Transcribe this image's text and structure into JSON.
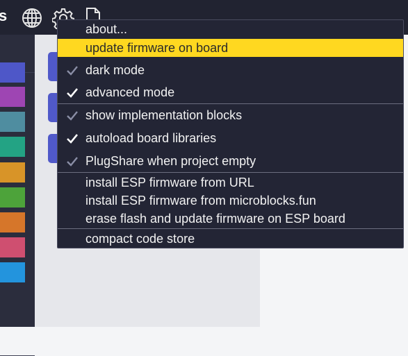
{
  "topbar": {
    "title_fragment": "s",
    "icons": [
      "globe-icon",
      "gear-icon",
      "file-icon"
    ]
  },
  "palette": {
    "category_colors": [
      "#4e57c8",
      "#9e45b3",
      "#4f8da0",
      "#23a384",
      "#d89428",
      "#4da33a",
      "#d6762a",
      "#cf4f70",
      "#2394dd"
    ]
  },
  "menu": {
    "items": [
      {
        "label": "about...",
        "check": "none",
        "highlight": false
      },
      {
        "label": "update firmware on board",
        "check": "none",
        "highlight": true
      },
      {
        "label": "dark mode",
        "check": "dim",
        "highlight": false
      },
      {
        "label": "advanced mode",
        "check": "bright",
        "highlight": false
      },
      {
        "label": "show implementation blocks",
        "check": "dim",
        "highlight": false
      },
      {
        "label": "autoload board libraries",
        "check": "bright",
        "highlight": false
      },
      {
        "label": "PlugShare when project empty",
        "check": "dim",
        "highlight": false
      },
      {
        "label": "install ESP firmware from URL",
        "check": "none",
        "highlight": false
      },
      {
        "label": "install ESP firmware from microblocks.fun",
        "check": "none",
        "highlight": false
      },
      {
        "label": "erase flash and update firmware on ESP board",
        "check": "none",
        "highlight": false
      },
      {
        "label": "compact code store",
        "check": "none",
        "highlight": false
      }
    ]
  },
  "colors": {
    "highlight": "#ffd820",
    "menu_bg": "#232535",
    "check_bright": "#ffffff",
    "check_dim": "#8a8ea6"
  }
}
